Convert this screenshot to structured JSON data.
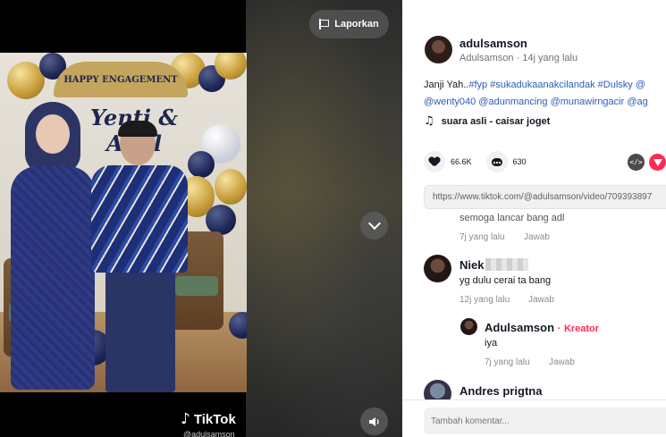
{
  "video": {
    "report_label": "Laporkan",
    "banner_text": "HAPPY ENGAGEMENT",
    "names_text": "Yenti & Adul",
    "tiktok_wordmark": "TikTok",
    "watermark_user": "@adulsamson",
    "icons": {
      "report": "flag-icon",
      "next": "chevron-down-icon",
      "volume": "speaker-icon"
    }
  },
  "post": {
    "author_name": "adulsamson",
    "author_sub": "Adulsamson · 14j yang lalu",
    "caption_line1_text": "Janji Yah..",
    "caption_line1_tags": "#fyp #sukadukaanakcilandak #Dulsky @",
    "caption_line2": "@wenty040 @adunmancing @munawirngacir @ag",
    "music": "suara asli - caisar joget",
    "likes": "66.6K",
    "comments_count": "630",
    "url": "https://www.tiktok.com/@adulsamson/video/709393897"
  },
  "comments": {
    "partial_text": "semoga lancar bang adl",
    "partial_meta_time": "7j yang lalu",
    "reply_label": "Jawab",
    "c1_name": "Niek",
    "c1_text": "yg dulu cerai ta bang",
    "c1_time": "12j yang lalu",
    "c2_name": "Adulsamson",
    "c2_creator": "Kreator",
    "c2_sep": "·",
    "c2_text": "iya",
    "c2_time": "7j yang lalu",
    "c3_name": "Andres prigtna"
  },
  "composer": {
    "placeholder": "Tambah komentar..."
  },
  "colors": {
    "accent": "#fe2c55",
    "link": "#2b5db9",
    "panel_bg": "#ffffff",
    "video_bg": "#000000"
  }
}
